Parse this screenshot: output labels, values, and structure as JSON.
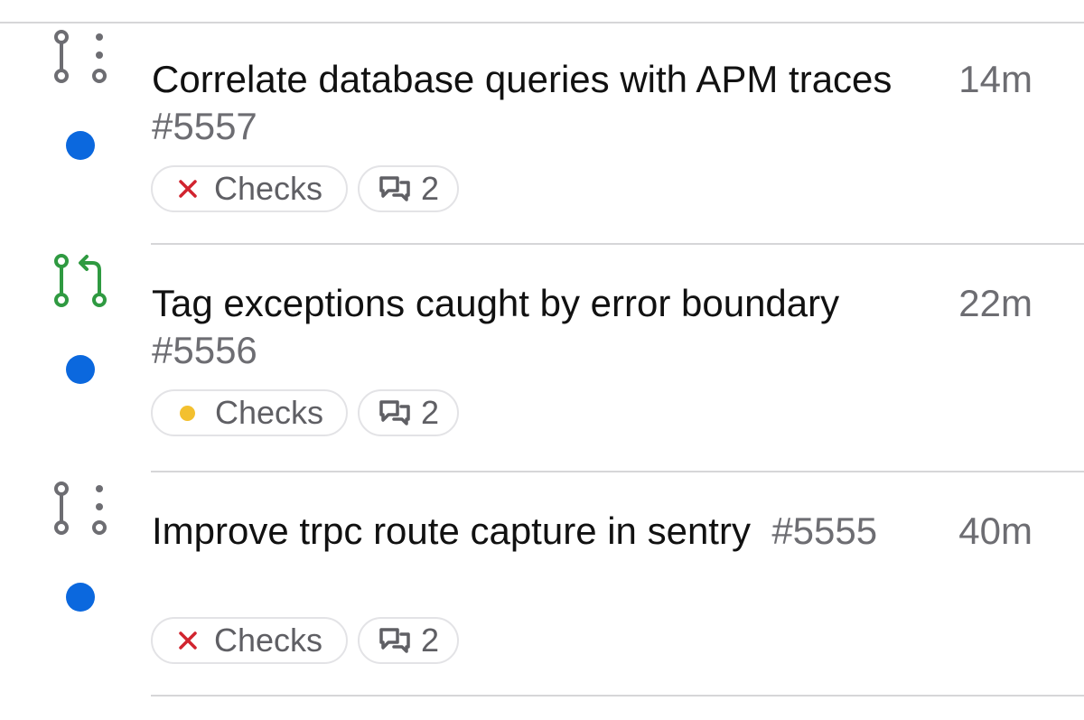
{
  "pull_requests": [
    {
      "title": "Correlate database queries with APM traces",
      "number": "#5557",
      "time": "14m",
      "state": "draft",
      "state_icon": "draft-pull-request-icon",
      "checks_label": "Checks",
      "checks_status": "failed",
      "checks_color": "#d1242f",
      "comments_count": "2"
    },
    {
      "title": "Tag exceptions caught by error boundary",
      "number": "#5556",
      "time": "22m",
      "state": "open",
      "state_icon": "pull-request-icon",
      "checks_label": "Checks",
      "checks_status": "pending",
      "checks_color": "#f3c02f",
      "comments_count": "2"
    },
    {
      "title": "Improve trpc route capture in sentry",
      "number": "#5555",
      "time": "40m",
      "state": "draft",
      "state_icon": "draft-pull-request-icon",
      "checks_label": "Checks",
      "checks_status": "failed",
      "checks_color": "#d1242f",
      "comments_count": "2"
    }
  ],
  "colors": {
    "unread_dot": "#0b68de",
    "open_pr_icon": "#2f9a41",
    "draft_pr_icon": "#6d6d72",
    "title_text": "#111111",
    "meta_text": "#6d6d72"
  }
}
